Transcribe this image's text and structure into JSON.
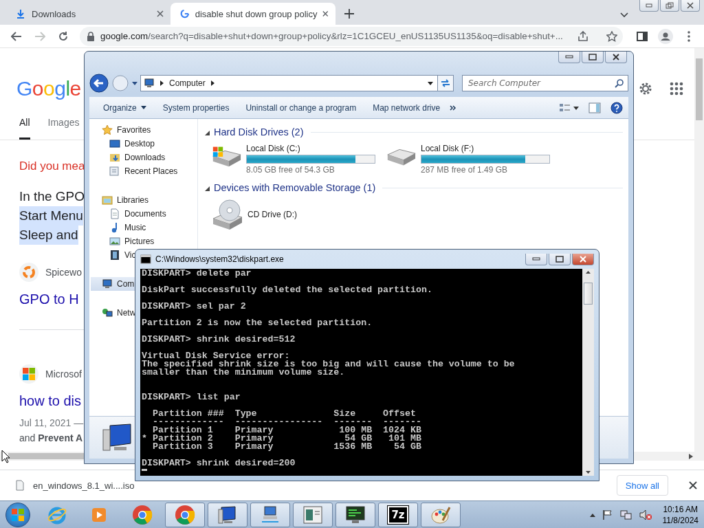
{
  "browser": {
    "tabs": [
      {
        "title": "Downloads",
        "kind": "download",
        "selected": false
      },
      {
        "title": "disable shut down group policy",
        "kind": "google",
        "selected": true
      }
    ],
    "forward_disabled": true,
    "url": {
      "host": "google.com",
      "rest": "/search?q=disable+shut+down+group+policy&rlz=1C1GCEU_enUS1135US1135&oq=disable+shut+..."
    }
  },
  "google": {
    "logo": "Google",
    "tabs": [
      {
        "label": "All",
        "selected": true
      },
      {
        "label": "Images",
        "selected": false
      }
    ],
    "suggestion": "Did you mea",
    "snippet": [
      {
        "text": "In the GPO",
        "highlighted": false
      },
      {
        "text": "Start Menu",
        "highlighted": true
      },
      {
        "text": "Sleep and",
        "highlighted": true
      }
    ],
    "results": [
      {
        "kind": "spiceworks",
        "source": "Spicewo",
        "title": "GPO to H"
      },
      {
        "kind": "microsoft",
        "source": "Microsof",
        "title": "how to dis",
        "date": "Jul 11, 2021 —",
        "snippet": "and **Prevent A**"
      }
    ]
  },
  "explorer": {
    "breadcrumb": [
      "Computer"
    ],
    "search_placeholder": "Search Computer",
    "toolbar": [
      {
        "label": "Organize",
        "menu": true
      },
      {
        "label": "System properties",
        "menu": false
      },
      {
        "label": "Uninstall or change a program",
        "menu": false
      },
      {
        "label": "Map network drive",
        "menu": false
      }
    ],
    "sidebar": [
      {
        "label": "Favorites",
        "kind": "star",
        "selected": false,
        "children": [
          {
            "label": "Desktop",
            "kind": "desktop",
            "selected": false
          },
          {
            "label": "Downloads",
            "kind": "downloads",
            "selected": false
          },
          {
            "label": "Recent Places",
            "kind": "recent",
            "selected": false
          }
        ]
      },
      {
        "label": "Libraries",
        "kind": "library",
        "selected": false,
        "children": [
          {
            "label": "Documents",
            "kind": "document",
            "selected": false
          },
          {
            "label": "Music",
            "kind": "music",
            "selected": false
          },
          {
            "label": "Pictures",
            "kind": "pictures",
            "selected": false
          },
          {
            "label": "Vic",
            "kind": "video",
            "selected": false
          }
        ]
      },
      {
        "label": "Com",
        "kind": "computer",
        "selected": true
      },
      {
        "label": "Netw",
        "kind": "network",
        "selected": false
      }
    ],
    "groups": [
      {
        "title": "Hard Disk Drives (2)",
        "expanded": true,
        "items": [
          {
            "kind": "system_disk",
            "name": "Local Disk (C:)",
            "free": "8.05 GB free of 54.3 GB",
            "level": 0.85
          },
          {
            "kind": "disk",
            "name": "Local Disk (F:)",
            "free": "287 MB free of 1.49 GB",
            "level": 0.81
          }
        ]
      },
      {
        "title": "Devices with Removable Storage (1)",
        "expanded": true,
        "items": [
          {
            "kind": "optical",
            "name": "CD Drive (D:)"
          }
        ]
      }
    ]
  },
  "console": {
    "title": "C:\\Windows\\system32\\diskpart.exe",
    "blocks": [
      {
        "kind": "prompt",
        "lines": [
          "DISKPART> delete par"
        ]
      },
      {
        "kind": "output",
        "lines": [
          "DiskPart successfully deleted the selected partition."
        ]
      },
      {
        "kind": "prompt",
        "lines": [
          "DISKPART> sel par 2"
        ]
      },
      {
        "kind": "output",
        "lines": [
          "Partition 2 is now the selected partition."
        ]
      },
      {
        "kind": "prompt",
        "lines": [
          "DISKPART> shrink desired=512"
        ]
      },
      {
        "kind": "error",
        "lines": [
          "Virtual Disk Service error:",
          "The specified shrink size is too big and will cause the volume to be",
          "smaller than the minimum volume size."
        ]
      },
      {
        "kind": "prompt",
        "lines": [
          "DISKPART> list par"
        ]
      },
      {
        "kind": "table",
        "lines": [
          "  Partition ###  Type              Size     Offset",
          "  -------------  ----------------  -------  -------",
          "  Partition 1    Primary            100 MB  1024 KB",
          "* Partition 2    Primary             54 GB   101 MB",
          "  Partition 3    Primary           1536 MB    54 GB"
        ]
      },
      {
        "kind": "prompt",
        "lines": [
          "DISKPART> shrink desired=200"
        ]
      }
    ]
  },
  "downloads_bar": {
    "file": "en_windows_8.1_wi....iso",
    "button": "Show all"
  },
  "taskbar": {
    "apps": [
      {
        "kind": "ie",
        "running": false
      },
      {
        "kind": "media",
        "running": false
      },
      {
        "kind": "chrome",
        "running": false
      },
      {
        "kind": "chrome",
        "running": true
      },
      {
        "kind": "computer",
        "running": true
      },
      {
        "kind": "network",
        "running": true
      },
      {
        "kind": "window",
        "running": true
      },
      {
        "kind": "monitor",
        "running": true
      },
      {
        "kind": "archive",
        "running": true,
        "label": "7z"
      },
      {
        "kind": "paint",
        "running": true
      }
    ],
    "time": "10:16 AM",
    "date": "11/8/2024"
  }
}
